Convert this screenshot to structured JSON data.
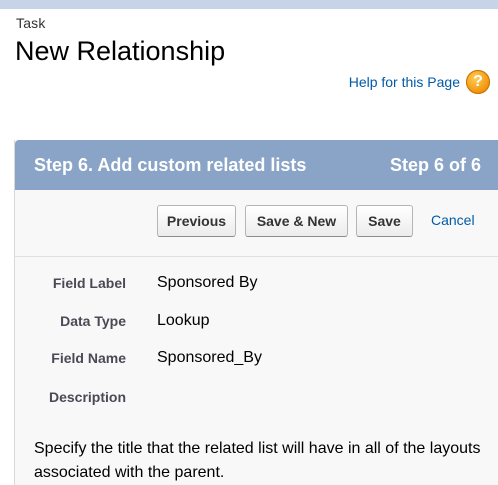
{
  "header": {
    "breadcrumb": "Task",
    "title": "New Relationship"
  },
  "help": {
    "link_label": "Help for this Page",
    "icon_glyph": "?"
  },
  "wizard": {
    "step_title": "Step 6. Add custom related lists",
    "step_counter": "Step 6 of 6"
  },
  "toolbar": {
    "previous_label": "Previous",
    "save_new_label": "Save & New",
    "save_label": "Save",
    "cancel_label": "Cancel"
  },
  "fields": [
    {
      "label": "Field Label",
      "value": "Sponsored By"
    },
    {
      "label": "Data Type",
      "value": "Lookup"
    },
    {
      "label": "Field Name",
      "value": "Sponsored_By"
    },
    {
      "label": "Description",
      "value": ""
    }
  ],
  "instructions": "Specify the title that the related list will have in all of the layouts associated with the parent.",
  "colors": {
    "header_bar": "#8aa4c8",
    "link": "#015ba7",
    "help_icon": "#f29a14",
    "top_strip": "#c7d3e6"
  }
}
